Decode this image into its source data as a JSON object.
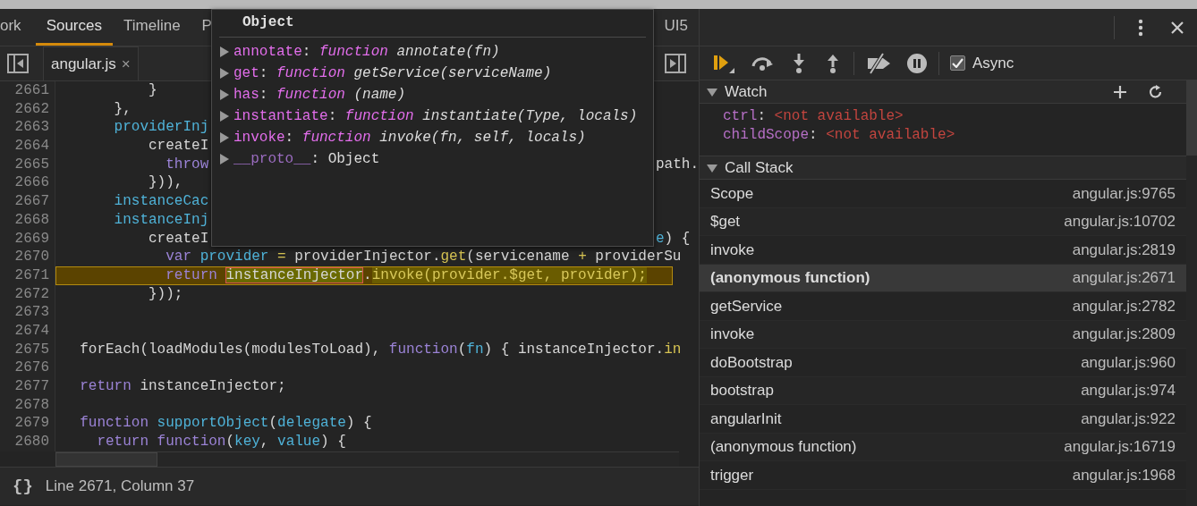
{
  "panel_tabs": [
    {
      "label": "ork",
      "selected": false
    },
    {
      "label": "Sources",
      "selected": true
    },
    {
      "label": "Timeline",
      "selected": false
    },
    {
      "label": "P",
      "selected": false
    },
    {
      "label": "UI5",
      "selected": false
    }
  ],
  "file_tabs": [
    {
      "label": "angular.js",
      "close": "×",
      "selected": true
    }
  ],
  "code": {
    "lines": [
      {
        "number": "2661",
        "segments": [
          {
            "text": "          }",
            "kind": "plain"
          }
        ]
      },
      {
        "number": "2662",
        "segments": [
          {
            "text": "      },",
            "kind": "plain"
          }
        ]
      },
      {
        "number": "2663",
        "segments": [
          {
            "text": "      providerInj",
            "kind": "variable"
          }
        ]
      },
      {
        "number": "2664",
        "segments": [
          {
            "text": "          createI",
            "kind": "plain"
          }
        ]
      },
      {
        "number": "2665",
        "segments": [
          {
            "text": "            throw",
            "kind": "keyword"
          }
        ],
        "after": [
          {
            "text": "path.",
            "kind": "plain"
          }
        ]
      },
      {
        "number": "2666",
        "segments": [
          {
            "text": "          })),",
            "kind": "plain"
          }
        ]
      },
      {
        "number": "2667",
        "segments": [
          {
            "text": "      instanceCac",
            "kind": "variable"
          }
        ]
      },
      {
        "number": "2668",
        "segments": [
          {
            "text": "      instanceInj",
            "kind": "variable"
          }
        ]
      },
      {
        "number": "2669",
        "segments": [
          {
            "text": "          createI",
            "kind": "plain"
          }
        ],
        "after": [
          {
            "text": "e",
            "kind": "variable"
          },
          {
            "text": ") {",
            "kind": "plain"
          }
        ]
      },
      {
        "number": "2670",
        "current": false,
        "segments": [
          {
            "text": "            var",
            "kind": "keyword"
          },
          {
            "text": " provider",
            "kind": "variable"
          },
          {
            "text": " = ",
            "kind": "operator"
          },
          {
            "text": "providerInjector.",
            "kind": "plain"
          },
          {
            "text": "get",
            "kind": "method"
          },
          {
            "text": "(servicename ",
            "kind": "plain"
          },
          {
            "text": "+",
            "kind": "operator"
          },
          {
            "text": " providerSu",
            "kind": "plain"
          }
        ]
      },
      {
        "number": "2671",
        "current": true,
        "segments": [
          {
            "text": "            return ",
            "kind": "keyword"
          },
          {
            "text": "instanceInjector",
            "kind": "target"
          },
          {
            "text": ".",
            "kind": "plain"
          },
          {
            "text": "invoke(provider.$get, provider);",
            "kind": "evaluated"
          }
        ]
      },
      {
        "number": "2672",
        "segments": [
          {
            "text": "          }));",
            "kind": "plain"
          }
        ]
      },
      {
        "number": "2673"
      },
      {
        "number": "2674"
      },
      {
        "number": "2675",
        "segments": [
          {
            "text": "  forEach(loadModules(modulesToLoad), ",
            "kind": "plain"
          },
          {
            "text": "function",
            "kind": "keyword"
          },
          {
            "text": "(",
            "kind": "plain"
          },
          {
            "text": "fn",
            "kind": "variable"
          },
          {
            "text": ") { instanceInjector.",
            "kind": "plain"
          },
          {
            "text": "in",
            "kind": "method"
          }
        ]
      },
      {
        "number": "2676"
      },
      {
        "number": "2677",
        "segments": [
          {
            "text": "  return",
            "kind": "keyword"
          },
          {
            "text": " instanceInjector;",
            "kind": "plain"
          }
        ]
      },
      {
        "number": "2678"
      },
      {
        "number": "2679",
        "segments": [
          {
            "text": "  function",
            "kind": "keyword"
          },
          {
            "text": " supportObject",
            "kind": "variable"
          },
          {
            "text": "(",
            "kind": "plain"
          },
          {
            "text": "delegate",
            "kind": "variable"
          },
          {
            "text": ") {",
            "kind": "plain"
          }
        ]
      },
      {
        "number": "2680",
        "segments": [
          {
            "text": "    return function",
            "kind": "keyword"
          },
          {
            "text": "(",
            "kind": "plain"
          },
          {
            "text": "key",
            "kind": "variable"
          },
          {
            "text": ", ",
            "kind": "plain"
          },
          {
            "text": "value",
            "kind": "variable"
          },
          {
            "text": ") {",
            "kind": "plain"
          }
        ]
      }
    ]
  },
  "popover": {
    "title": "Object",
    "properties": [
      {
        "name": "annotate",
        "separator": ":",
        "kind": "function",
        "expanded": false,
        "keyword": "function",
        "signature": "annotate(fn)"
      },
      {
        "name": "get",
        "separator": ":",
        "kind": "function",
        "expanded": false,
        "keyword": "function",
        "signature": "getService(serviceName)"
      },
      {
        "name": "has",
        "separator": ":",
        "kind": "function",
        "expanded": false,
        "keyword": "function",
        "signature": "(name)"
      },
      {
        "name": "instantiate",
        "separator": ":",
        "kind": "function",
        "expanded": false,
        "keyword": "function",
        "signature": "instantiate(Type, locals)"
      },
      {
        "name": "invoke",
        "separator": ":",
        "kind": "function",
        "expanded": false,
        "keyword": "function",
        "signature": "invoke(fn, self, locals)"
      },
      {
        "name": "__proto__",
        "separator": ":",
        "kind": "object",
        "expanded": false,
        "value": "Object"
      }
    ]
  },
  "status_bar": {
    "format_button": "{}",
    "position": "Line 2671, Column 37"
  },
  "debugger": {
    "async": {
      "label": "Async",
      "checked": true
    },
    "watch": {
      "title": "Watch",
      "expanded": true,
      "entries": [
        {
          "name": "ctrl",
          "separator": ":",
          "value": "<not available>"
        },
        {
          "name": "childScope",
          "separator": ":",
          "value": "<not available>"
        }
      ]
    },
    "call_stack": {
      "title": "Call Stack",
      "expanded": true,
      "frames": [
        {
          "name": "Scope",
          "location": "angular.js:9765",
          "selected": false
        },
        {
          "name": "$get",
          "location": "angular.js:10702",
          "selected": false
        },
        {
          "name": "invoke",
          "location": "angular.js:2819",
          "selected": false
        },
        {
          "name": "(anonymous function)",
          "location": "angular.js:2671",
          "selected": true
        },
        {
          "name": "getService",
          "location": "angular.js:2782",
          "selected": false
        },
        {
          "name": "invoke",
          "location": "angular.js:2809",
          "selected": false
        },
        {
          "name": "doBootstrap",
          "location": "angular.js:960",
          "selected": false
        },
        {
          "name": "bootstrap",
          "location": "angular.js:974",
          "selected": false
        },
        {
          "name": "angularInit",
          "location": "angular.js:922",
          "selected": false
        },
        {
          "name": "(anonymous function)",
          "location": "angular.js:16719",
          "selected": false
        },
        {
          "name": "trigger",
          "location": "angular.js:1968",
          "selected": false
        }
      ]
    }
  }
}
